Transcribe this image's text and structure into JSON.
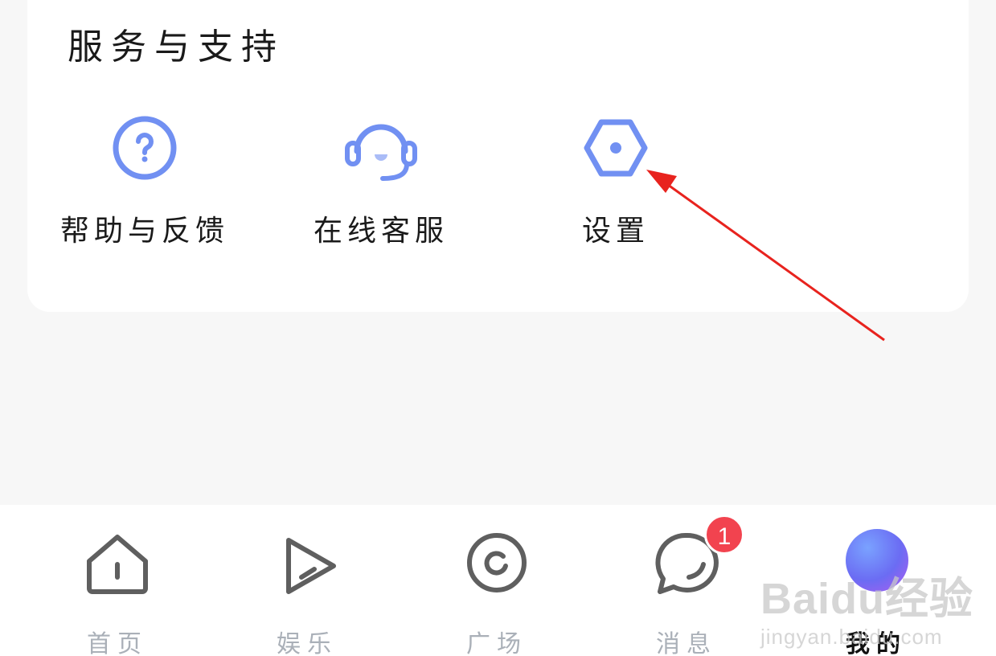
{
  "section": {
    "title": "服务与支持",
    "items": [
      {
        "label": "帮助与反馈",
        "icon": "help-icon"
      },
      {
        "label": "在线客服",
        "icon": "headset-icon"
      },
      {
        "label": "设置",
        "icon": "settings-icon"
      }
    ]
  },
  "tabbar": {
    "tabs": [
      {
        "label": "首页",
        "icon": "home-icon"
      },
      {
        "label": "娱乐",
        "icon": "play-icon"
      },
      {
        "label": "广场",
        "icon": "plaza-icon"
      },
      {
        "label": "消息",
        "icon": "message-icon"
      },
      {
        "label": "我的",
        "icon": "avatar"
      }
    ],
    "active_index": 4,
    "message_badge": "1"
  },
  "watermark": {
    "brand": "Baidu经验",
    "url": "jingyan.baidu.com"
  },
  "colors": {
    "accent": "#7190f2",
    "badge": "#f2434f",
    "tab_inactive": "#aab0b8",
    "icon_gray": "#5f5f5f",
    "annotation_arrow": "#e8231e"
  }
}
